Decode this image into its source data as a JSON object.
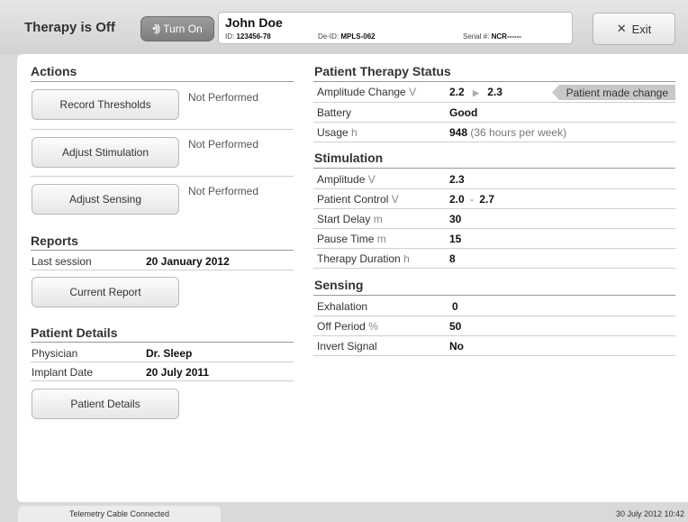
{
  "header": {
    "therapy_status": "Therapy is Off",
    "turn_on_label": "Turn On",
    "exit_label": "Exit",
    "patient": {
      "name": "John Doe",
      "id_label": "ID:",
      "id_value": "123456-78",
      "deid_label": "De-ID:",
      "deid_value": "MPLS-062",
      "serial_label": "Serial #:",
      "serial_value": "NCR------"
    }
  },
  "actions": {
    "title": "Actions",
    "items": [
      {
        "button": "Record Thresholds",
        "status": "Not Performed"
      },
      {
        "button": "Adjust Stimulation",
        "status": "Not Performed"
      },
      {
        "button": "Adjust Sensing",
        "status": "Not Performed"
      }
    ]
  },
  "reports": {
    "title": "Reports",
    "last_session_label": "Last session",
    "last_session_value": "20 January 2012",
    "current_report_button": "Current Report"
  },
  "patient_details": {
    "title": "Patient Details",
    "physician_label": "Physician",
    "physician_value": "Dr. Sleep",
    "implant_label": "Implant Date",
    "implant_value": "20 July 2011",
    "button": "Patient Details"
  },
  "therapy_status": {
    "title": "Patient Therapy Status",
    "amplitude_change": {
      "label": "Amplitude Change",
      "unit": "V",
      "from": "2.2",
      "to": "2.3",
      "tag": "Patient made change"
    },
    "battery": {
      "label": "Battery",
      "value": "Good"
    },
    "usage": {
      "label": "Usage",
      "unit": "h",
      "value": "948",
      "note": "(36 hours per week)"
    }
  },
  "stimulation": {
    "title": "Stimulation",
    "amplitude": {
      "label": "Amplitude",
      "unit": "V",
      "value": "2.3"
    },
    "patient_control": {
      "label": "Patient Control",
      "unit": "V",
      "min": "2.0",
      "sep": "-",
      "max": "2.7"
    },
    "start_delay": {
      "label": "Start Delay",
      "unit": "m",
      "value": "30"
    },
    "pause_time": {
      "label": "Pause Time",
      "unit": "m",
      "value": "15"
    },
    "therapy_duration": {
      "label": "Therapy Duration",
      "unit": "h",
      "value": "8"
    }
  },
  "sensing": {
    "title": "Sensing",
    "exhalation": {
      "label": "Exhalation",
      "value": "0"
    },
    "off_period": {
      "label": "Off Period",
      "unit": "%",
      "value": "50"
    },
    "invert_signal": {
      "label": "Invert Signal",
      "value": "No"
    }
  },
  "footer": {
    "status": "Telemetry Cable Connected",
    "datetime": "30 July 2012 10:42"
  },
  "icons": {
    "turn_on": "signal-waves-icon",
    "exit": "close-x-icon",
    "arrow": "right-triangle-arrow-icon"
  }
}
